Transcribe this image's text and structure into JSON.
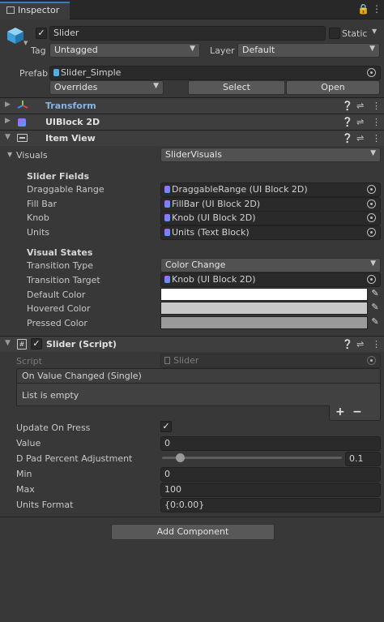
{
  "window": {
    "tab_label": "Inspector"
  },
  "object": {
    "name": "Slider",
    "active": true,
    "static_label": "Static",
    "tag_label": "Tag",
    "tag_value": "Untagged",
    "layer_label": "Layer",
    "layer_value": "Default",
    "prefab_label": "Prefab",
    "prefab_value": "Slider_Simple",
    "overrides_label": "Overrides",
    "select_label": "Select",
    "open_label": "Open"
  },
  "components": {
    "transform": "Transform",
    "uiblock": "UIBlock 2D",
    "itemview": "Item View"
  },
  "itemview": {
    "visuals_label": "Visuals",
    "visuals_value": "SliderVisuals",
    "slider_fields_header": "Slider Fields",
    "fields": [
      {
        "label": "Draggable Range",
        "value": "DraggableRange (UI Block 2D)"
      },
      {
        "label": "Fill Bar",
        "value": "FillBar (UI Block 2D)"
      },
      {
        "label": "Knob",
        "value": "Knob (UI Block 2D)"
      },
      {
        "label": "Units",
        "value": "Units (Text Block)"
      }
    ],
    "visual_states_header": "Visual States",
    "transition_type_label": "Transition Type",
    "transition_type_value": "Color Change",
    "transition_target_label": "Transition Target",
    "transition_target_value": "Knob (UI Block 2D)",
    "colors": [
      {
        "label": "Default Color",
        "hex": "#ffffff"
      },
      {
        "label": "Hovered Color",
        "hex": "#c8c8c8"
      },
      {
        "label": "Pressed Color",
        "hex": "#9a9a9a"
      }
    ]
  },
  "script": {
    "title": "Slider (Script)",
    "enabled": true,
    "script_label": "Script",
    "script_value": "Slider",
    "event_header": "On Value Changed (Single)",
    "event_empty": "List is empty",
    "add_symbol": "+",
    "remove_symbol": "−",
    "update_on_press_label": "Update On Press",
    "update_on_press": true,
    "value_label": "Value",
    "value": "0",
    "dpad_label": "D Pad Percent Adjustment",
    "dpad_value": "0.1",
    "dpad_fraction": 0.1,
    "min_label": "Min",
    "min": "0",
    "max_label": "Max",
    "max": "100",
    "units_format_label": "Units Format",
    "units_format": "{0:0.00}"
  },
  "add_component_label": "Add Component",
  "icons": [
    "lock-icon",
    "menu-icon",
    "cube-icon",
    "help-icon",
    "preset-icon",
    "more-icon",
    "target-picker-icon",
    "eyedropper-icon",
    "script-icon"
  ],
  "colors": {
    "accent": "#3a79bb",
    "transform_title": "#87b4e8",
    "background": "#383838"
  }
}
